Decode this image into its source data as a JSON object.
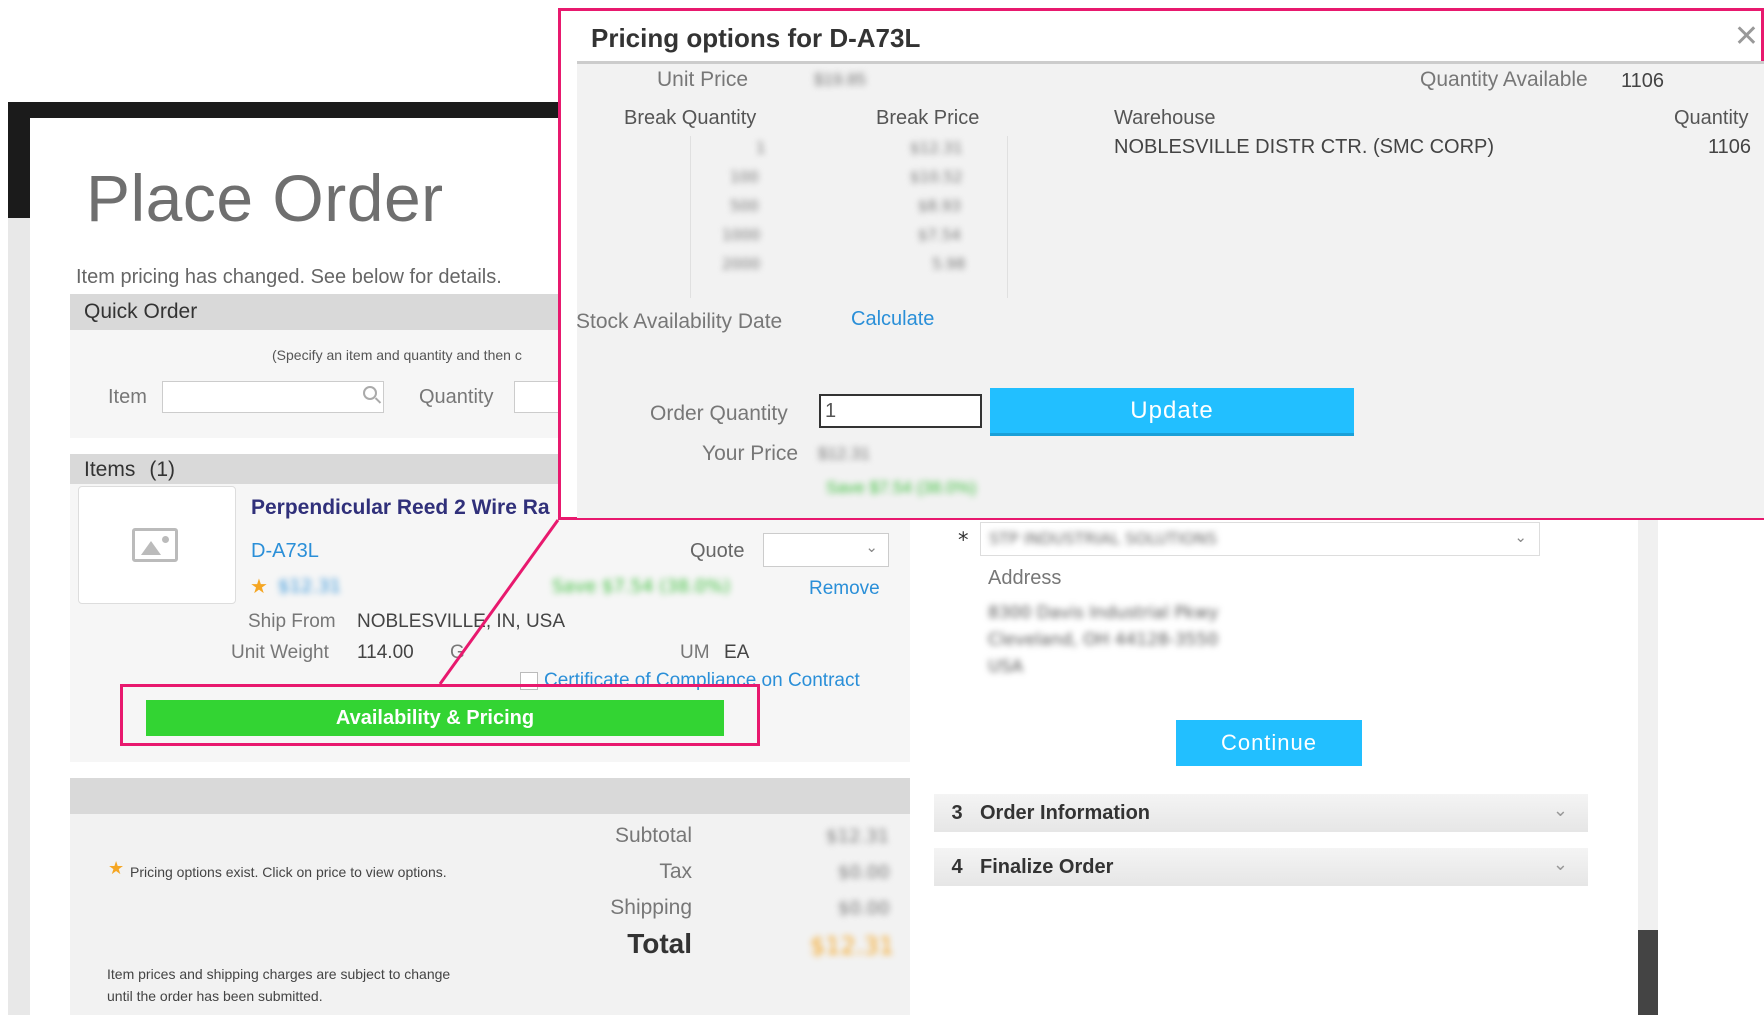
{
  "page": {
    "title": "Place Order",
    "pricing_changed_message": "Item pricing has changed. See below for details."
  },
  "quick_order": {
    "heading": "Quick Order",
    "hint": "(Specify an item and quantity and then c",
    "item_label": "Item",
    "item_placeholder": "",
    "quantity_label": "Quantity"
  },
  "items": {
    "heading": "Items",
    "count": "(1)",
    "product": {
      "name": "Perpendicular Reed 2 Wire Ra",
      "sku": "D-A73L",
      "price": "$12.31",
      "savings": "Save $7.54 (38.0%)",
      "quote_label": "Quote",
      "remove_label": "Remove",
      "ship_from_label": "Ship From",
      "ship_from_value": "NOBLESVILLE, IN, USA",
      "unit_weight_label": "Unit Weight",
      "unit_weight_value": "114.00",
      "unit_weight_unit": "G",
      "um_label": "UM",
      "um_value": "EA",
      "certificate_label": "Certificate of Compliance on Contract",
      "availability_button": "Availability & Pricing"
    }
  },
  "summary": {
    "pricing_note": "Pricing options exist. Click on price to view options.",
    "subtotal_label": "Subtotal",
    "subtotal_value": "$12.31",
    "tax_label": "Tax",
    "tax_value": "$0.00",
    "shipping_label": "Shipping",
    "shipping_value": "$0.00",
    "total_label": "Total",
    "total_value": "$12.31",
    "disclaimer_line1": "Item prices and shipping charges are subject to change",
    "disclaimer_line2": "until the order has been submitted."
  },
  "checkout": {
    "required_mark": "*",
    "ship_to_value": "STP INDUSTRIAL SOLUTIONS",
    "address_label": "Address",
    "address_lines": [
      "8300 Davis Industrial Pkwy",
      "Cleveland, OH 44128-3550",
      "USA"
    ],
    "continue_button": "Continue",
    "steps": [
      {
        "number": "3",
        "label": "Order Information"
      },
      {
        "number": "4",
        "label": "Finalize Order"
      }
    ]
  },
  "modal": {
    "title": "Pricing options for D-A73L",
    "close_glyph": "✕",
    "unit_price_label": "Unit Price",
    "unit_price_value": "$19.85",
    "quantity_available_label": "Quantity Available",
    "quantity_available_value": "1106",
    "break_quantity_label": "Break Quantity",
    "break_price_label": "Break Price",
    "breaks": [
      {
        "qty": "1",
        "price": "$12.31"
      },
      {
        "qty": "100",
        "price": "$10.52"
      },
      {
        "qty": "500",
        "price": "$8.93"
      },
      {
        "qty": "1000",
        "price": "$7.54"
      },
      {
        "qty": "2000",
        "price": "5.98"
      }
    ],
    "warehouse_label": "Warehouse",
    "warehouse_value": "NOBLESVILLE DISTR CTR. (SMC CORP)",
    "warehouse_quantity_label": "Quantity",
    "warehouse_quantity_value": "1106",
    "stock_date_label": "Stock Availability Date",
    "calculate_link": "Calculate",
    "order_quantity_label": "Order Quantity",
    "order_quantity_value": "1",
    "update_button": "Update",
    "your_price_label": "Your Price",
    "your_price_value": "$12.31",
    "your_savings": "Save $7.54 (38.0%)"
  },
  "colors": {
    "highlight": "#e8196e",
    "primary_button": "#22bfff",
    "availability_button": "#33d433",
    "link": "#2a8fd8",
    "savings": "#3bbf3b",
    "star": "#f5a623"
  }
}
